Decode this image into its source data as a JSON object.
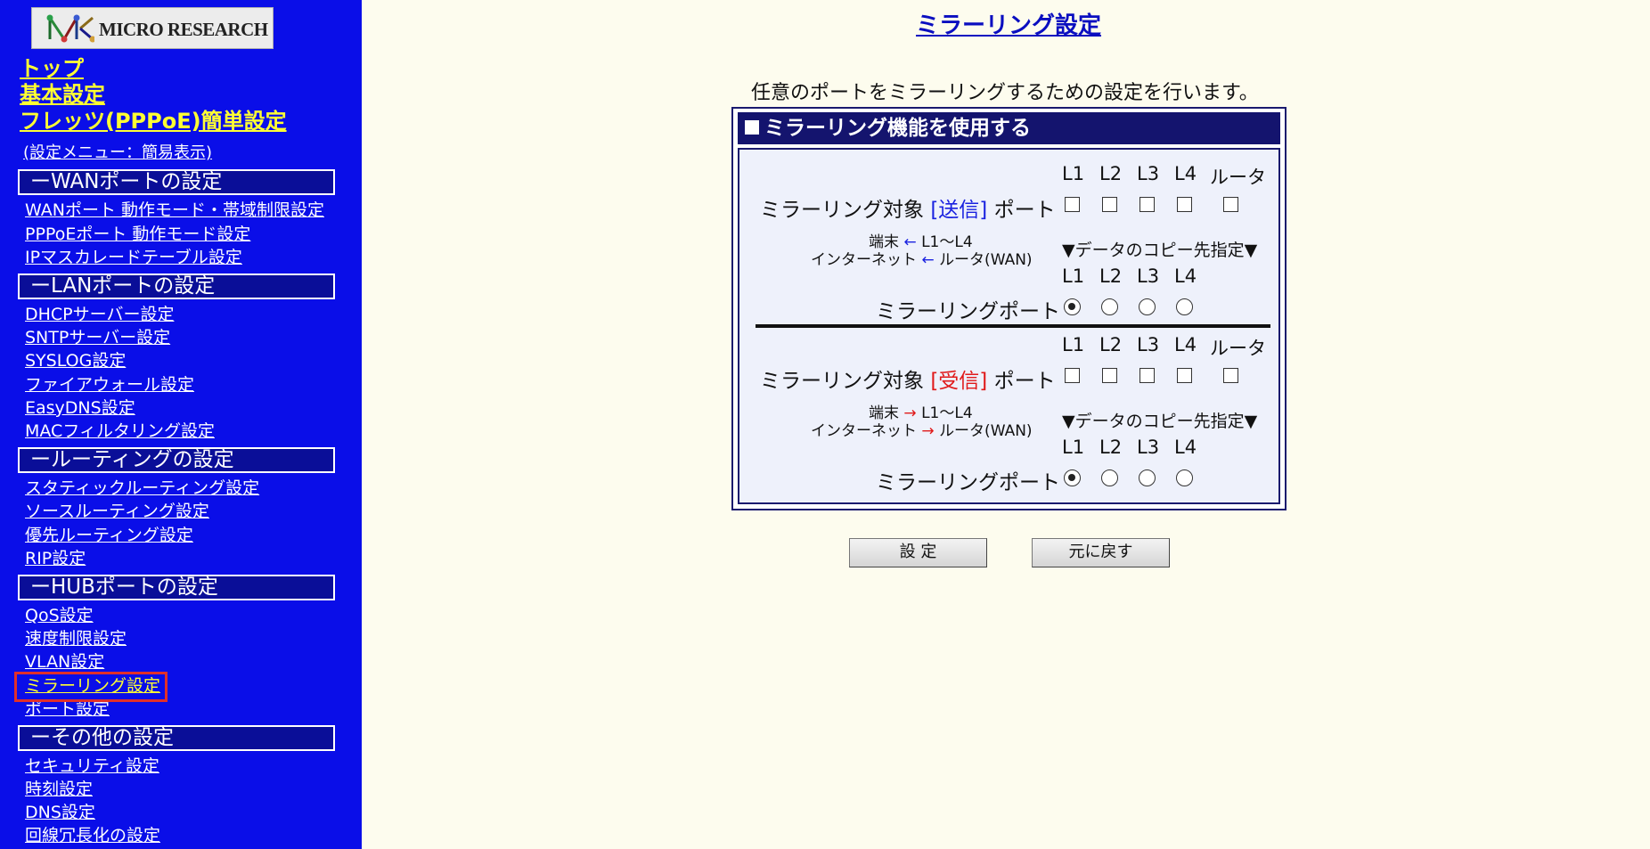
{
  "logo": {
    "brand_text": "MICRO RESEARCH",
    "icon": "microresearch-logo-icon"
  },
  "top_links": [
    "トップ",
    "基本設定",
    "フレッツ(PPPoE)簡単設定"
  ],
  "menu_note": "(設定メニュー：簡易表示)",
  "menu": [
    {
      "section": "ーWANポートの設定",
      "items": [
        "WANポート 動作モード・帯域制限設定",
        "PPPoEポート 動作モード設定",
        "IPマスカレードテーブル設定"
      ]
    },
    {
      "section": "ーLANポートの設定",
      "items": [
        "DHCPサーバー設定",
        "SNTPサーバー設定",
        "SYSLOG設定",
        "ファイアウォール設定",
        "EasyDNS設定",
        "MACフィルタリング設定"
      ]
    },
    {
      "section": "ールーティングの設定",
      "items": [
        "スタティックルーティング設定",
        "ソースルーティング設定",
        "優先ルーティング設定",
        "RIP設定"
      ]
    },
    {
      "section": "ーHUBポートの設定",
      "items": [
        "QoS設定",
        "速度制限設定",
        "VLAN設定",
        "ミラーリング設定",
        "ポート設定"
      ]
    },
    {
      "section": "ーその他の設定",
      "items": [
        "セキュリティ設定",
        "時刻設定",
        "DNS設定",
        "回線冗長化の設定"
      ]
    }
  ],
  "active_item": "ミラーリング設定",
  "main": {
    "title": "ミラーリング設定",
    "description": "任意のポートをミラーリングするための設定を行います。",
    "enable_label": "ミラーリング機能を使用する",
    "enable_checked": false,
    "port_headers": [
      "L1",
      "L2",
      "L3",
      "L4",
      "ルータ"
    ],
    "mirror_port_headers": [
      "L1",
      "L2",
      "L3",
      "L4"
    ],
    "send": {
      "target_prefix": "ミラーリング対象",
      "target_tag": "[送信]",
      "target_suffix": "ポート",
      "tag_color": "#1a22e0",
      "flow_line1_a": "端末",
      "flow_line1_b": "L1〜L4",
      "flow_line2_a": "インターネット",
      "flow_line2_b": "ルータ(WAN)",
      "arrow": "←",
      "copy_dest": "▼データのコピー先指定▼",
      "mirror_port_label": "ミラーリングポート",
      "target_checked": [
        false,
        false,
        false,
        false,
        false
      ],
      "mirror_selected": "L1"
    },
    "recv": {
      "target_prefix": "ミラーリング対象",
      "target_tag": "[受信]",
      "target_suffix": "ポート",
      "tag_color": "#e01a1a",
      "flow_line1_a": "端末",
      "flow_line1_b": "L1〜L4",
      "flow_line2_a": "インターネット",
      "flow_line2_b": "ルータ(WAN)",
      "arrow": "→",
      "copy_dest": "▼データのコピー先指定▼",
      "mirror_port_label": "ミラーリングポート",
      "target_checked": [
        false,
        false,
        false,
        false,
        false
      ],
      "mirror_selected": "L1"
    },
    "buttons": {
      "apply": "設 定",
      "reset": "元に戻す"
    }
  }
}
